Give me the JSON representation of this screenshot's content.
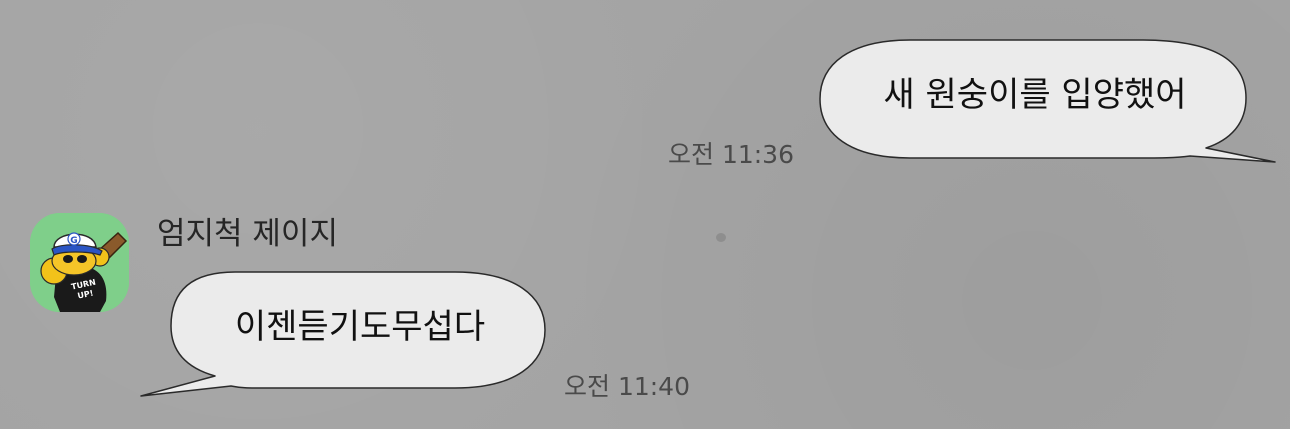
{
  "chat": {
    "messages": [
      {
        "direction": "outgoing",
        "text": "새 원숭이를 입양했어",
        "time": "오전 11:36"
      },
      {
        "direction": "incoming",
        "sender": "엄지척 제이지",
        "avatar_icon": "jay-g-baseball-cap-character",
        "avatar_caption": "TURN UP!",
        "text": "이젠듣기도무섭다",
        "time": "오전 11:40"
      }
    ]
  },
  "colors": {
    "background": "#a4a4a4",
    "bubble_fill": "#ebebeb",
    "bubble_stroke": "#2a2a2a",
    "avatar_bg": "#7fcf8a",
    "timestamp": "#4a4a4a"
  }
}
